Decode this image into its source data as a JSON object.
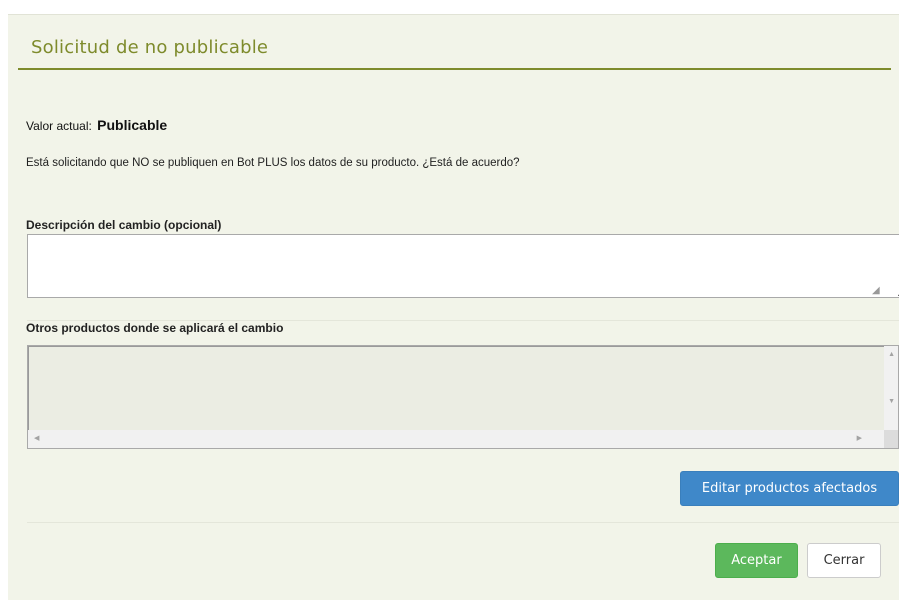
{
  "dialog": {
    "title": "Solicitud de no publicable",
    "current_value_label": "Valor actual:",
    "current_value": "Publicable",
    "question": "Está solicitando que NO se publiquen en Bot PLUS los datos de su producto. ¿Está de acuerdo?",
    "description_label": "Descripción del cambio (opcional)",
    "description_value": "",
    "other_products_label": "Otros productos donde se aplicará el cambio",
    "other_products": [],
    "edit_button": "Editar productos afectados",
    "accept_button": "Aceptar",
    "close_button": "Cerrar"
  },
  "colors": {
    "title": "#7e8b2c",
    "background": "#f2f4e9",
    "edit_button": "#3f88c9",
    "accept_button": "#5cb85c"
  }
}
